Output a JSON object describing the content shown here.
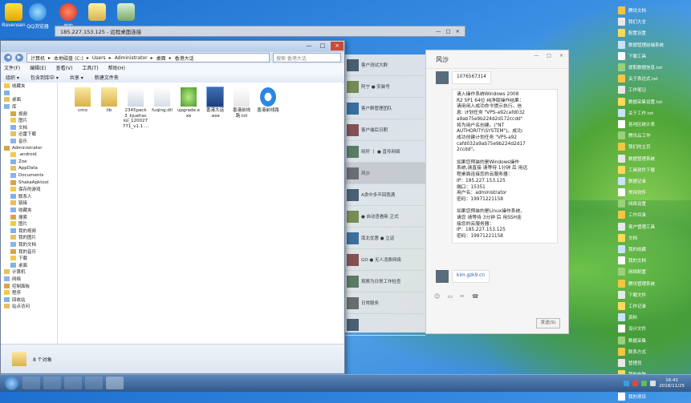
{
  "desktop": {
    "top_icons": [
      {
        "label": "Ravensen"
      },
      {
        "label": "QQ浏览器"
      },
      {
        "label": "搜狗"
      },
      {
        "label": ""
      },
      {
        "label": ""
      }
    ],
    "right_icons": [
      "腾讯文档",
      "我们大全",
      "配置设置",
      "数据管理前端系统",
      "下载工具",
      "提取数据信息.txt",
      "关于表达式.txt",
      "工作笔记",
      "数据采集设置.txt",
      "关于工作.txt",
      "各地区统计表",
      "腾讯云工作",
      "我们的主页",
      "数据管理系统",
      "工具软件下载",
      "数据记录",
      "常用软件",
      "网络设置",
      "工作目录",
      "客户管理工具",
      "文档",
      "我的收藏",
      "我的文档",
      "网络配置",
      "腾讯管理系统",
      "下载文件",
      "工作记录",
      "资料",
      "设计文件",
      "数据采集",
      "联系方式",
      "管理员",
      "我的电脑",
      "工作流",
      "我的项目"
    ]
  },
  "remote_bar": {
    "title": "185.227.153.125 - 远程桌面连接",
    "controls": [
      "—",
      "□",
      "×"
    ]
  },
  "explorer": {
    "address": [
      "计算机",
      "本地磁盘 (C:)",
      "Users",
      "Administrator",
      "桌面",
      "香港大话"
    ],
    "search_placeholder": "搜索 香港大话",
    "menu": [
      "文件(F)",
      "编辑(E)",
      "查看(V)",
      "工具(T)",
      "帮助(H)"
    ],
    "toolbar": [
      "组织 ▾",
      "包含到库中 ▾",
      "共享 ▾",
      "新建文件夹"
    ],
    "nav_items": [
      {
        "label": "收藏夹",
        "indent": 0
      },
      {
        "label": "",
        "indent": 0
      },
      {
        "label": "桌面",
        "indent": 0
      },
      {
        "label": "库",
        "indent": 0
      },
      {
        "label": "视频",
        "indent": 1
      },
      {
        "label": "图片",
        "indent": 1
      },
      {
        "label": "文档",
        "indent": 1
      },
      {
        "label": "迅雷下载",
        "indent": 1
      },
      {
        "label": "音乐",
        "indent": 1
      },
      {
        "label": "Administrator",
        "indent": 0
      },
      {
        "label": ".android",
        "indent": 1
      },
      {
        "label": "Zoe",
        "indent": 1
      },
      {
        "label": "AppData",
        "indent": 1
      },
      {
        "label": "Documents",
        "indent": 1
      },
      {
        "label": "ShakaApktool",
        "indent": 1
      },
      {
        "label": "保存的游戏",
        "indent": 1
      },
      {
        "label": "联系人",
        "indent": 1
      },
      {
        "label": "链接",
        "indent": 1
      },
      {
        "label": "收藏夹",
        "indent": 1
      },
      {
        "label": "搜索",
        "indent": 1
      },
      {
        "label": "图片",
        "indent": 1
      },
      {
        "label": "我的视频",
        "indent": 1
      },
      {
        "label": "我的图片",
        "indent": 1
      },
      {
        "label": "我的文档",
        "indent": 1
      },
      {
        "label": "我的音乐",
        "indent": 1
      },
      {
        "label": "下载",
        "indent": 1
      },
      {
        "label": "桌面",
        "indent": 1
      },
      {
        "label": "计算机",
        "indent": 0
      },
      {
        "label": "网络",
        "indent": 0
      },
      {
        "label": "控制面板",
        "indent": 0
      },
      {
        "label": "程序",
        "indent": 0
      },
      {
        "label": "回收站",
        "indent": 0
      },
      {
        "label": "站点访问",
        "indent": 0
      }
    ],
    "files": [
      {
        "name": "cmo",
        "type": "folder"
      },
      {
        "name": "lib",
        "type": "folder"
      },
      {
        "name": "2345pack 3_kjuehac ko_120027 771_v1.1 ...",
        "type": "exe"
      },
      {
        "name": "fuqing.dll",
        "type": "dll"
      },
      {
        "name": "upgrade.e xe",
        "type": "upgrade"
      },
      {
        "name": "香港大话 .exe",
        "type": "app"
      },
      {
        "name": "香港前线 路.txt",
        "type": "txt"
      },
      {
        "name": "香港前线路",
        "type": "browser"
      }
    ],
    "status": "8 个对象"
  },
  "chatlist": {
    "items": [
      {
        "name": "客户测试大群",
        "sub": ""
      },
      {
        "name": "阿宁 ● 安装号",
        "sub": ""
      },
      {
        "name": "客户群管理团队",
        "sub": ""
      },
      {
        "name": "客户端后日期",
        "sub": ""
      },
      {
        "name": "晓轩 丨 ● 直传网络",
        "sub": ""
      },
      {
        "name": "风沙",
        "sub": ""
      },
      {
        "name": "A类中多不回我满",
        "sub": ""
      },
      {
        "name": "● 自动查看新 正式",
        "sub": ""
      },
      {
        "name": "南北优惠 ● 立返",
        "sub": ""
      },
      {
        "name": "GO ● 无人消费网络",
        "sub": ""
      },
      {
        "name": "观察为日常工作检查",
        "sub": ""
      },
      {
        "name": "日常服务",
        "sub": ""
      },
      {
        "name": "",
        "sub": ""
      }
    ]
  },
  "chat": {
    "title": "风沙",
    "controls": [
      "—",
      "□",
      "×"
    ],
    "msg1": "1076567314",
    "msg2_lines": [
      "请入操作系统Windows 2008",
      "R2 SP1 64位 纯净版操作结果：",
      "请用用入成功命令提示执行。信",
      "息: 计划任务 \"VPS-a92cafd032",
      "a9ab75e9b224d2d172ccdd\"",
      "将为用户名创建。(\"NT",
      "AUTHORITY\\SYSTEM\")。成功:",
      "成功创建计划任务 \"VPS-a92",
      "cafd032a9ab75e9b224d2d17",
      "2ccdd\"。",
      "",
      "如果您预装的是Windows操作",
      "系统,请直接 请等待 1分钟 后 用远",
      "程桌面连接您的云服务器：",
      "IP：185.227.153.125",
      "端口：15351",
      "用户名：administrator",
      "密码：19971221158",
      "",
      "如果您预装的是Linux操作系统,",
      "请您 请等待 3分钟 后 用SSH连",
      "接您的云服务器：",
      "IP：185.227.153.125",
      "密码：19971221158"
    ],
    "msg3": "kim.gzk9.cn",
    "tools": [
      "☺",
      "▭",
      "✂",
      "☎"
    ],
    "send_label": "发送(S)"
  },
  "taskbar": {
    "clock_time": "16:41",
    "clock_date": "2018/11/25"
  }
}
